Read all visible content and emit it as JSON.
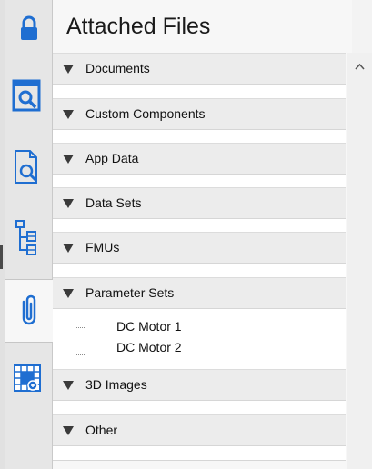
{
  "panel": {
    "title": "Attached Files"
  },
  "sidebar": {
    "items": [
      {
        "name": "lock",
        "icon": "lock-icon"
      },
      {
        "name": "library-browser",
        "icon": "library-browser-icon"
      },
      {
        "name": "document-search",
        "icon": "document-search-icon"
      },
      {
        "name": "model-tree",
        "icon": "model-tree-icon"
      },
      {
        "name": "attached-files",
        "icon": "paperclip-icon",
        "active": true
      },
      {
        "name": "component-grid",
        "icon": "component-grid-icon"
      }
    ]
  },
  "sections": [
    {
      "label": "Documents",
      "items": []
    },
    {
      "label": "Custom Components",
      "items": []
    },
    {
      "label": "App Data",
      "items": []
    },
    {
      "label": "Data Sets",
      "items": []
    },
    {
      "label": "FMUs",
      "items": []
    },
    {
      "label": "Parameter Sets",
      "items": [
        "DC Motor 1",
        "DC Motor 2"
      ]
    },
    {
      "label": "3D Images",
      "items": []
    },
    {
      "label": "Other",
      "items": []
    }
  ],
  "scrollbar": {
    "up_icon": "chevron-up-icon"
  },
  "colors": {
    "icon_blue": "#1f6ed1",
    "header_bg": "#ececec",
    "body_bg": "#ffffff"
  }
}
